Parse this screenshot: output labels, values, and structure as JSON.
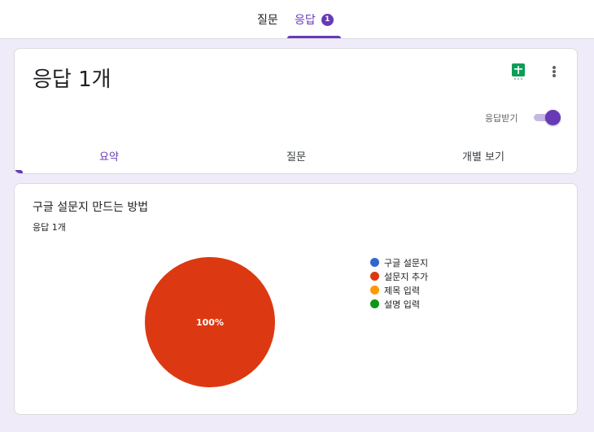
{
  "top_tabs": {
    "questions": "질문",
    "responses": "응답",
    "responses_badge": "1"
  },
  "header": {
    "title": "응답 1개",
    "accept_label": "응답받기",
    "accept_responses_on": true,
    "icons": [
      "sheets-icon",
      "more-vert-icon"
    ],
    "tabs": [
      "요약",
      "질문",
      "개별 보기"
    ],
    "active_tab": "요약"
  },
  "summary": {
    "question_title": "구글 설문지 만드는 방법",
    "response_count": "응답 1개",
    "chart_data": {
      "type": "pie",
      "labels": [
        "구글 설문지",
        "설문지 추가",
        "제목 입력",
        "설명 입력"
      ],
      "values": [
        0,
        100,
        0,
        0
      ],
      "colors": [
        "#3366cc",
        "#dc3912",
        "#ff9900",
        "#109618"
      ],
      "data_labels": [
        "",
        "100%",
        "",
        ""
      ],
      "legend_position": "right"
    }
  },
  "colors": {
    "accent": "#673ab7",
    "background": "#f0ebf8"
  }
}
